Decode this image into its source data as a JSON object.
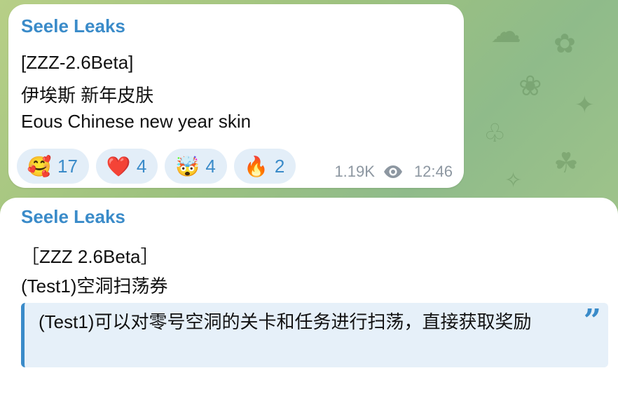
{
  "messages": [
    {
      "sender": "Seele Leaks",
      "lines": [
        "[ZZZ-2.6Beta]",
        "伊埃斯 新年皮肤",
        "Eous Chinese new year skin"
      ],
      "reactions": [
        {
          "emoji": "🥰",
          "icon": "smiling-face-with-hearts-icon",
          "count": "17"
        },
        {
          "emoji": "❤️",
          "icon": "red-heart-icon",
          "count": "4"
        },
        {
          "emoji": "🤯",
          "icon": "exploding-head-icon",
          "count": "4"
        },
        {
          "emoji": "🔥",
          "icon": "fire-icon",
          "count": "2"
        }
      ],
      "views": "1.19K",
      "time": "12:46"
    },
    {
      "sender": "Seele Leaks",
      "lines": [
        "［ZZZ 2.6Beta］",
        "(Test1)空洞扫荡券"
      ],
      "quote": "(Test1)可以对零号空洞的关卡和任务进行扫荡，直接获取奖励"
    }
  ],
  "colors": {
    "accent": "#3a8bc9",
    "reaction_bg": "#e3eef8",
    "quote_bg": "#e6f0f9",
    "meta": "#8d97a1"
  }
}
